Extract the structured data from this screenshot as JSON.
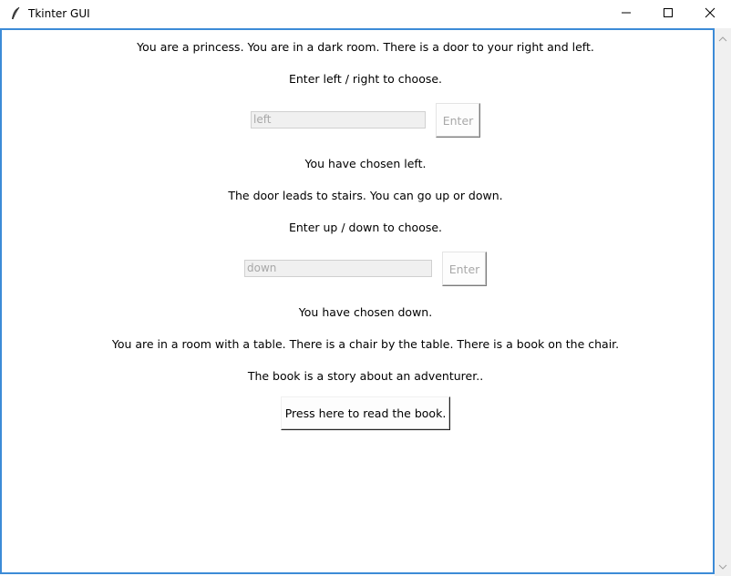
{
  "window": {
    "title": "Tkinter GUI",
    "icon": "feather-icon",
    "controls": [
      "minimize-icon",
      "maximize-icon",
      "close-icon"
    ]
  },
  "story": {
    "intro": "You are a princess. You are in a dark room. There is a door to your right and left.",
    "prompt1": "Enter left / right to choose.",
    "entry1_value": "left",
    "enter1_label": "Enter",
    "chosen1": "You have chosen left.",
    "stairs": "The door leads to stairs. You can go up or down.",
    "prompt2": "Enter up / down to choose.",
    "entry2_value": "down",
    "enter2_label": "Enter",
    "chosen2": "You have chosen down.",
    "room": "You are in a room with a table. There is a chair by the table. There is a book on the chair.",
    "book": "The book is a story about an adventurer..",
    "read_button": "Press here to read the book."
  },
  "colors": {
    "focus_border": "#3c8bd7",
    "disabled_text": "#a8a8a8",
    "entry_bg": "#f0f0f0"
  }
}
